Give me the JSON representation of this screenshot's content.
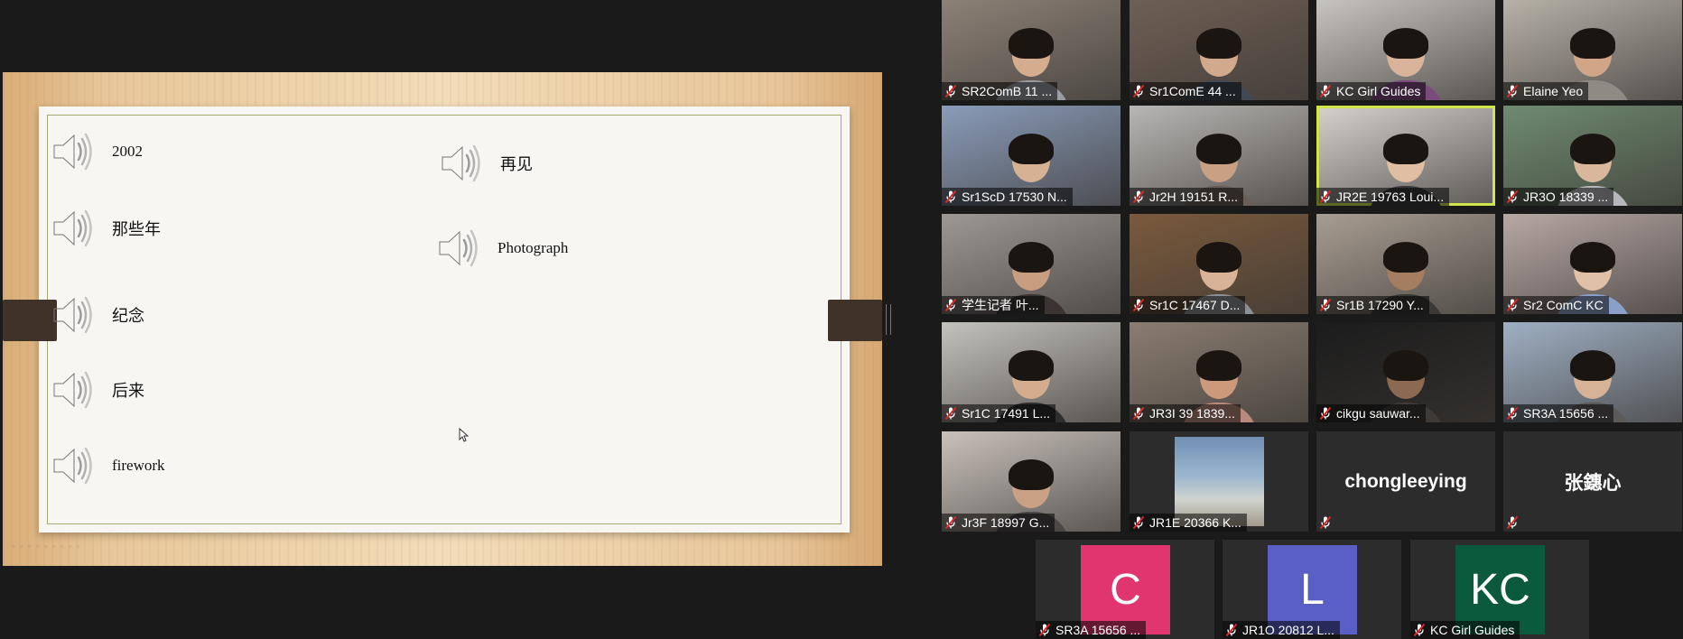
{
  "slide": {
    "items_left": [
      {
        "label": "2002",
        "serif": true
      },
      {
        "label": "那些年",
        "serif": false
      },
      {
        "label": "纪念",
        "serif": false
      },
      {
        "label": "后来",
        "serif": false
      },
      {
        "label": "firework",
        "serif": true
      }
    ],
    "items_right": [
      {
        "label": "再见",
        "serif": false
      },
      {
        "label": "Photograph",
        "serif": true
      }
    ]
  },
  "gallery": {
    "participants": [
      {
        "name": "SR2ComB 11 ...",
        "bg": "#8c8177",
        "shirt": "#9a9ca3",
        "skin": "#d6ac8e"
      },
      {
        "name": "Sr1ComE 44 ...",
        "bg": "#6e5f55",
        "shirt": "#3f4a56",
        "skin": "#d2a98c"
      },
      {
        "name": "KC Girl Guides",
        "bg": "#c7c4bf",
        "shirt": "#7d4a7e",
        "skin": "#d9b49b"
      },
      {
        "name": "Elaine Yeo",
        "bg": "#b7b1a8",
        "shirt": "#8f8a84",
        "skin": "#d0a588"
      },
      {
        "name": "Sr1ScD 17530 N...",
        "bg": "#8a9cb9",
        "shirt": "#6b6e75",
        "skin": "#d7b194"
      },
      {
        "name": "Jr2H 19151 R...",
        "bg": "#b8b6b4",
        "shirt": "#6a5e56",
        "skin": "#c9a083"
      },
      {
        "name": "JR2E 19763 Loui...",
        "bg": "#d6d3ce",
        "shirt": "#3a3a3c",
        "skin": "#dfbea4",
        "speaking": true
      },
      {
        "name": "JR3O 18339 ...",
        "bg": "#6f8b70",
        "shirt": "#b7b7bb",
        "skin": "#d8b79c"
      },
      {
        "name": "学生记者 叶...",
        "bg": "#9d9894",
        "shirt": "#3b3433",
        "skin": "#c89d80"
      },
      {
        "name": "Sr1C 17467 D...",
        "bg": "#7a5a3c",
        "shirt": "#8d8f93",
        "skin": "#d9b398"
      },
      {
        "name": "Sr1B 17290 Y...",
        "bg": "#a79d92",
        "shirt": "#3a3937",
        "skin": "#a57d61"
      },
      {
        "name": "Sr2 ComC KC",
        "bg": "#b7a8a4",
        "shirt": "#8aa0c8",
        "skin": "#e0c0a6"
      },
      {
        "name": "Sr1C 17491 L...",
        "bg": "#c4c2bc",
        "shirt": "#2e2e30",
        "skin": "#d4ac8e"
      },
      {
        "name": "JR3I 39 1839...",
        "bg": "#8a7d71",
        "shirt": "#b98a7c",
        "skin": "#cc9a7a"
      },
      {
        "name": "cikgu sauwar...",
        "bg": "#1c1c1c",
        "shirt": "#3d3a38",
        "skin": "#8c6a52"
      },
      {
        "name": "SR3A 15656 ...",
        "bg": "#9fb0c4",
        "shirt": "#5d5a5a",
        "skin": "#d6b296"
      },
      {
        "name": "Jr3F 18997 G...",
        "bg": "#c9c1bb",
        "shirt": "#4d4848",
        "skin": "#caa184"
      },
      {
        "name": "JR1E 20366 K...",
        "type": "sky"
      },
      {
        "name": "chongleeying",
        "type": "name"
      },
      {
        "name": "张鏸心",
        "type": "name"
      },
      {
        "name": "SR3A 15656 ...",
        "type": "avatar",
        "initials": "C",
        "color": "#e0356f"
      },
      {
        "name": "JR1O 20812 L...",
        "type": "avatar",
        "initials": "L",
        "color": "#5a5fc5"
      },
      {
        "name": "KC Girl Guides",
        "type": "avatar",
        "initials": "KC",
        "color": "#0c5a3e"
      }
    ]
  }
}
